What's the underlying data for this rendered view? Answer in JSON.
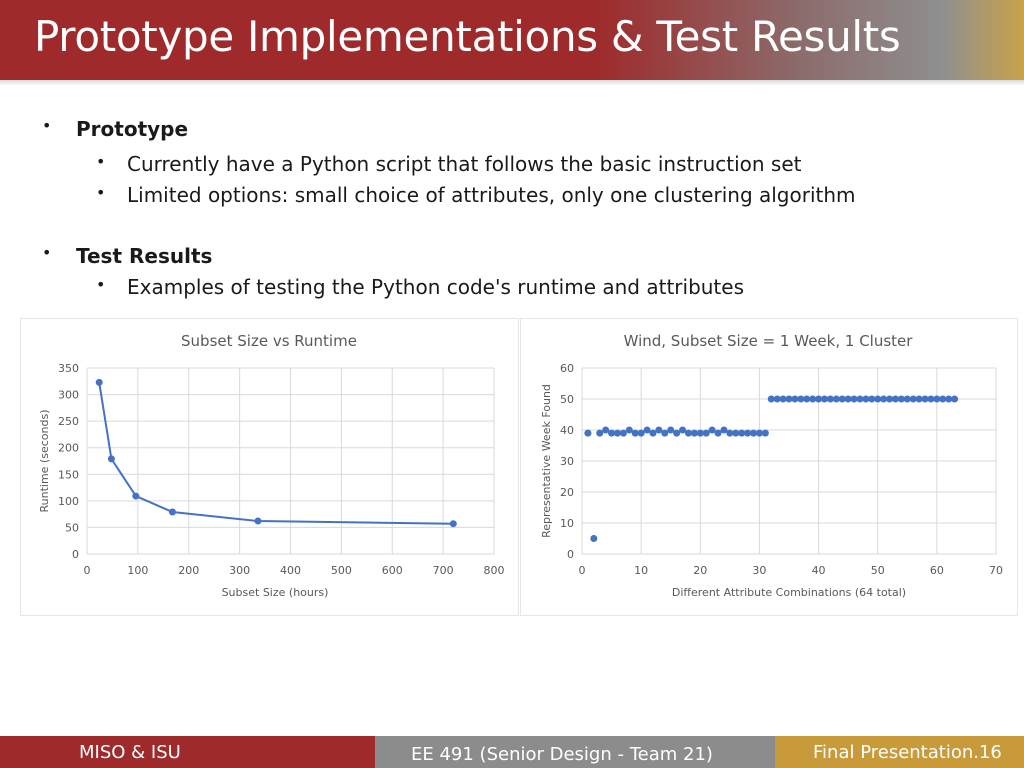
{
  "slide": {
    "title": "Prototype Implementations & Test Results",
    "sections": [
      {
        "heading": "Prototype",
        "items": [
          "Currently have a Python script that follows the basic instruction set",
          "Limited options: small choice of attributes, only one clustering algorithm"
        ]
      },
      {
        "heading": "Test Results",
        "items": [
          "Examples of testing the Python code's runtime and attributes"
        ]
      }
    ],
    "bullet_glyph": "•"
  },
  "footer": {
    "left": "MISO & ISU",
    "center": "EE 491 (Senior Design - Team 21)",
    "right": "Final Presentation.16"
  },
  "colors": {
    "title_bg": "#9e2a2b",
    "footer_gray": "#8c8c8c",
    "footer_gold": "#c89a3a",
    "series": "#4472c4"
  },
  "chart_data": [
    {
      "type": "line",
      "title": "Subset Size vs Runtime",
      "xlabel": "Subset Size (hours)",
      "ylabel": "Runtime (seconds)",
      "xlim": [
        0,
        800
      ],
      "ylim": [
        0,
        350
      ],
      "xticks": [
        0,
        100,
        200,
        300,
        400,
        500,
        600,
        700,
        800
      ],
      "yticks": [
        0,
        50,
        100,
        150,
        200,
        250,
        300,
        350
      ],
      "grid": true,
      "series": [
        {
          "x": [
            24,
            48,
            96,
            168,
            336,
            720
          ],
          "y": [
            323,
            179,
            109,
            79,
            62,
            57
          ]
        }
      ]
    },
    {
      "type": "scatter",
      "title": "Wind, Subset Size = 1 Week, 1 Cluster",
      "xlabel": "Different Attribute Combinations (64 total)",
      "ylabel": "Representative Week Found",
      "xlim": [
        0,
        70
      ],
      "ylim": [
        0,
        60
      ],
      "xticks": [
        0,
        10,
        20,
        30,
        40,
        50,
        60,
        70
      ],
      "yticks": [
        0,
        10,
        20,
        30,
        40,
        50,
        60
      ],
      "grid": true,
      "series": [
        {
          "x": [
            1,
            2,
            3,
            4,
            5,
            6,
            7,
            8,
            9,
            10,
            11,
            12,
            13,
            14,
            15,
            16,
            17,
            18,
            19,
            20,
            21,
            22,
            23,
            24,
            25,
            26,
            27,
            28,
            29,
            30,
            31,
            32,
            33,
            34,
            35,
            36,
            37,
            38,
            39,
            40,
            41,
            42,
            43,
            44,
            45,
            46,
            47,
            48,
            49,
            50,
            51,
            52,
            53,
            54,
            55,
            56,
            57,
            58,
            59,
            60,
            61,
            62,
            63
          ],
          "y": [
            39,
            5,
            39,
            40,
            39,
            39,
            39,
            40,
            39,
            39,
            40,
            39,
            40,
            39,
            40,
            39,
            40,
            39,
            39,
            39,
            39,
            40,
            39,
            40,
            39,
            39,
            39,
            39,
            39,
            39,
            39,
            50,
            50,
            50,
            50,
            50,
            50,
            50,
            50,
            50,
            50,
            50,
            50,
            50,
            50,
            50,
            50,
            50,
            50,
            50,
            50,
            50,
            50,
            50,
            50,
            50,
            50,
            50,
            50,
            50,
            50,
            50,
            50
          ]
        }
      ]
    }
  ]
}
